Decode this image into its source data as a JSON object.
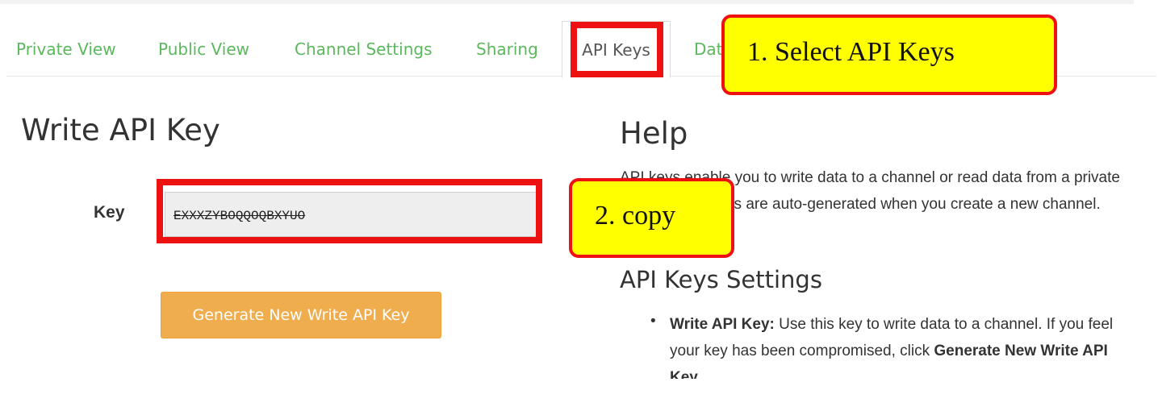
{
  "tabs": [
    {
      "label": "Private View"
    },
    {
      "label": "Public View"
    },
    {
      "label": "Channel Settings"
    },
    {
      "label": "Sharing"
    },
    {
      "label": "API Keys"
    },
    {
      "label": "Dat"
    }
  ],
  "write_key": {
    "title": "Write API Key",
    "key_label": "Key",
    "key_value": "EXXXZYBOQQOQBXYUO",
    "generate_button": "Generate New Write API Key"
  },
  "help": {
    "title": "Help",
    "text": "API keys enable you to write data to a channel or read data from a private channel. API keys are auto-generated when you create a new channel.",
    "settings_title": "API Keys Settings",
    "settings_items": [
      {
        "bold": "Write API Key:",
        "text": " Use this key to write data to a channel. If you feel your key has been compromised, click ",
        "link": "Generate New Write API Key",
        "end": "."
      }
    ]
  },
  "annotations": {
    "step1": "1. Select API Keys",
    "step2": "2. copy",
    "highlight_color": "#ee1111",
    "callout_color": "#ffff00"
  },
  "colors": {
    "tab_text": "#5cb85c",
    "button": "#f0ad4e"
  }
}
